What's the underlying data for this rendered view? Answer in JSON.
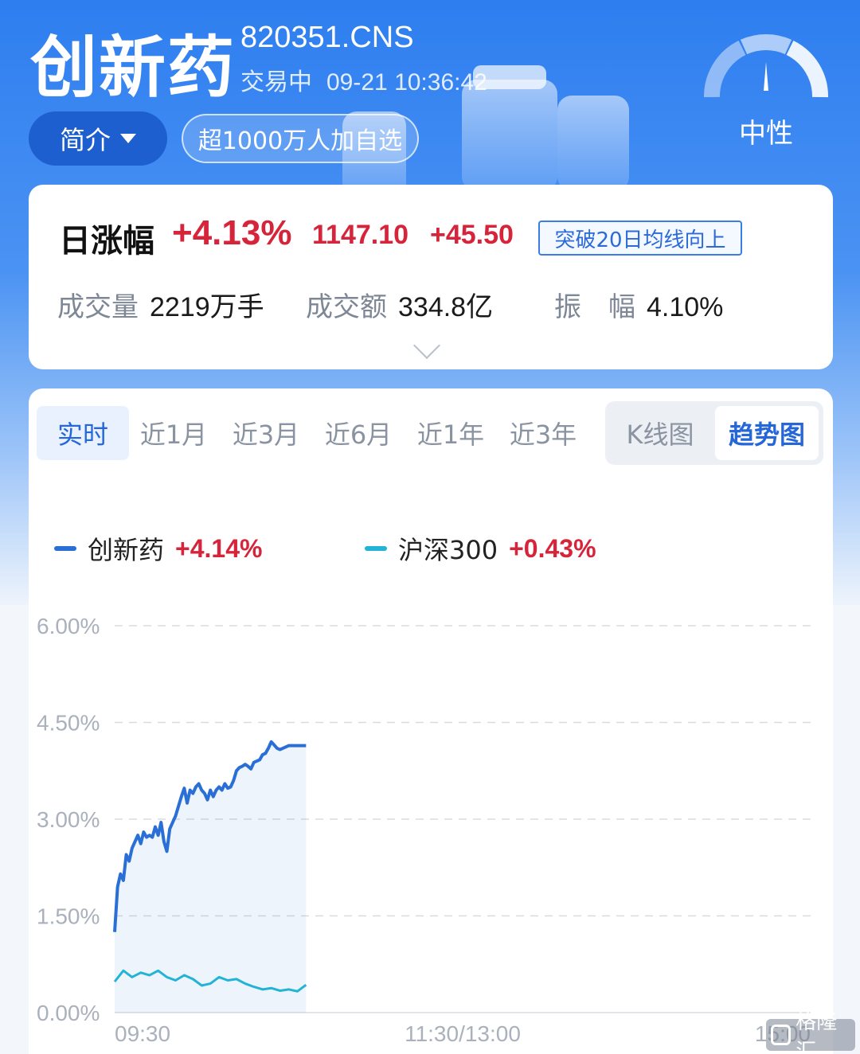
{
  "header": {
    "title": "创新药",
    "code": "820351.CNS",
    "trade_status": "交易中",
    "datetime": "09-21 10:36:42",
    "intro_button": "简介",
    "watchlist_badge": "超1000万人加自选",
    "sentiment_label": "中性"
  },
  "summary": {
    "title": "日涨幅",
    "change_pct": "+4.13%",
    "price": "1147.10",
    "change_abs": "+45.50",
    "signal_badge": "突破20日均线向上",
    "volume_label": "成交量",
    "volume_value": "2219万手",
    "turnover_label": "成交额",
    "turnover_value": "334.8亿",
    "amplitude_label": "振　幅",
    "amplitude_value": "4.10%"
  },
  "tabs": {
    "items": [
      "实时",
      "近1月",
      "近3月",
      "近6月",
      "近1年",
      "近3年"
    ],
    "active": "实时"
  },
  "view_toggle": {
    "kline": "K线图",
    "trend": "趋势图",
    "active": "趋势图"
  },
  "legend": {
    "series1_name": "创新药",
    "series1_change": "+4.14%",
    "series2_name": "沪深300",
    "series2_change": "+0.43%"
  },
  "colors": {
    "series1": "#2a6fd6",
    "series2": "#22b3d6",
    "up_red": "#d6243a",
    "accent": "#2566d8"
  },
  "chart_data": {
    "type": "line",
    "title": "",
    "xlabel": "",
    "ylabel": "",
    "x_ticks": [
      "09:30",
      "11:30/13:00",
      "15:00"
    ],
    "y_ticks": [
      "6.00%",
      "4.50%",
      "3.00%",
      "1.50%",
      "0.00%"
    ],
    "ylim": [
      0,
      6
    ],
    "x_range_minutes": [
      0,
      240
    ],
    "grid": true,
    "legend_position": "top-left",
    "series": [
      {
        "name": "创新药",
        "x": [
          0,
          1,
          2,
          3,
          4,
          5,
          6,
          7,
          8,
          9,
          10,
          11,
          12,
          13,
          14,
          15,
          16,
          17,
          18,
          19,
          20,
          21,
          22,
          23,
          24,
          25,
          26,
          27,
          28,
          29,
          30,
          31,
          32,
          33,
          34,
          35,
          36,
          37,
          38,
          39,
          40,
          41,
          42,
          43,
          44,
          45,
          46,
          47,
          48,
          49,
          50,
          51,
          52,
          53,
          54,
          55,
          56,
          57,
          58,
          59,
          60,
          61,
          62,
          63,
          64,
          65,
          66
        ],
        "values": [
          1.25,
          1.95,
          2.15,
          2.05,
          2.45,
          2.35,
          2.55,
          2.65,
          2.75,
          2.62,
          2.8,
          2.72,
          2.75,
          2.72,
          2.88,
          2.75,
          2.95,
          2.65,
          2.5,
          2.85,
          2.95,
          3.05,
          3.2,
          3.35,
          3.48,
          3.25,
          3.45,
          3.4,
          3.5,
          3.55,
          3.45,
          3.4,
          3.3,
          3.45,
          3.35,
          3.45,
          3.5,
          3.45,
          3.55,
          3.48,
          3.5,
          3.6,
          3.75,
          3.8,
          3.82,
          3.85,
          3.82,
          3.78,
          3.88,
          3.9,
          3.92,
          4.0,
          4.02,
          4.1,
          4.2,
          4.15,
          4.1,
          4.08,
          4.1,
          4.12,
          4.14,
          4.14,
          4.14,
          4.14,
          4.14,
          4.14,
          4.14
        ]
      },
      {
        "name": "沪深300",
        "x": [
          0,
          3,
          6,
          9,
          12,
          15,
          18,
          21,
          24,
          27,
          30,
          33,
          36,
          39,
          42,
          45,
          48,
          51,
          54,
          57,
          60,
          63,
          66
        ],
        "values": [
          0.48,
          0.65,
          0.55,
          0.62,
          0.58,
          0.65,
          0.55,
          0.5,
          0.58,
          0.52,
          0.42,
          0.45,
          0.55,
          0.5,
          0.52,
          0.45,
          0.4,
          0.36,
          0.38,
          0.34,
          0.36,
          0.33,
          0.43
        ]
      }
    ]
  },
  "watermark": {
    "text": "格隆汇"
  }
}
